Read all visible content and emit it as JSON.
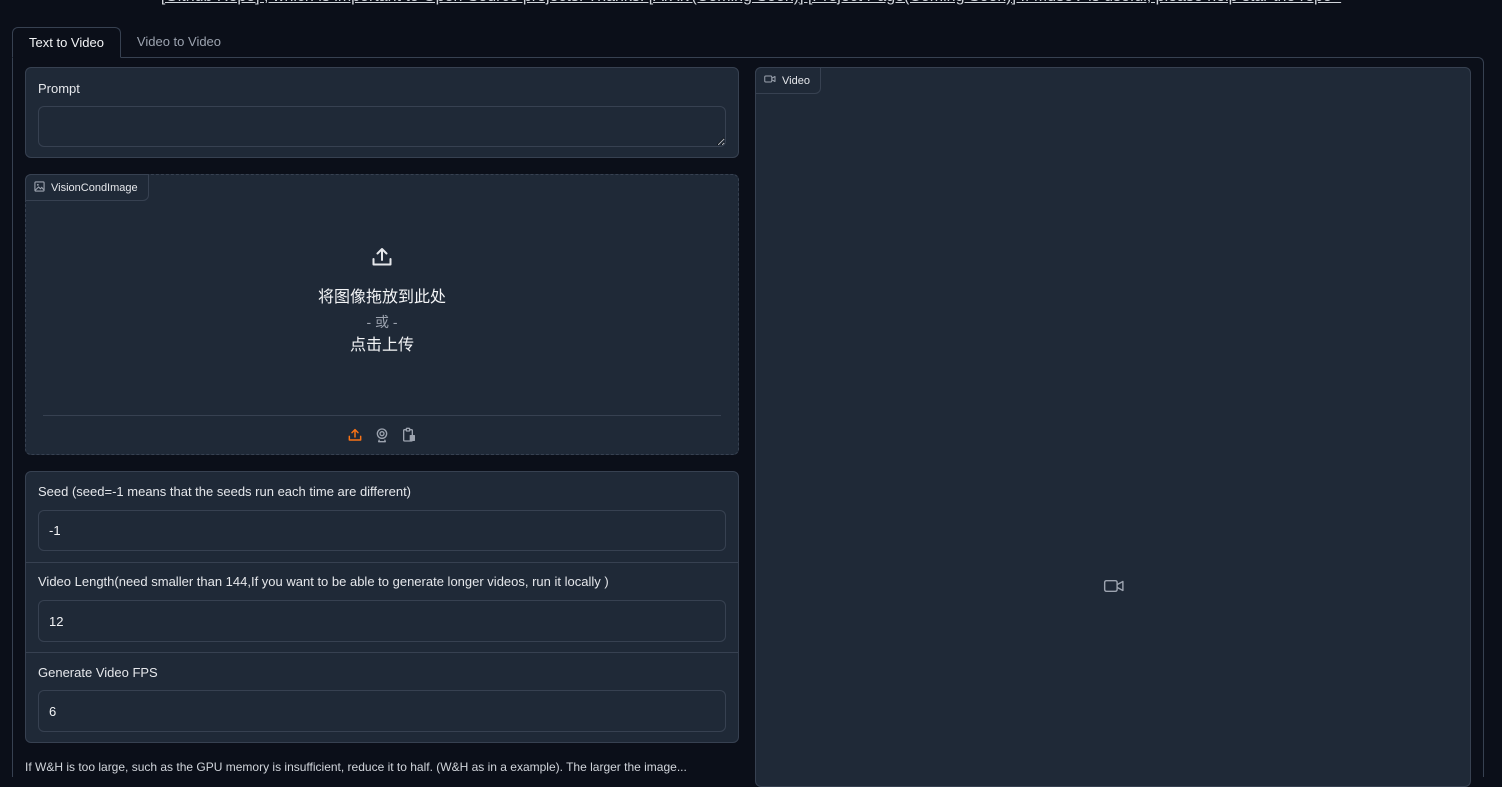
{
  "banner": {
    "text": "[Github Repo] , which is important to Open-Source projects. Thanks! [ArXiv(Coming Soon)] [Project Page(Coming Soon)] If MuseV is useful, please help star the repo~"
  },
  "tabs": [
    {
      "label": "Text to Video",
      "active": true
    },
    {
      "label": "Video to Video",
      "active": false
    }
  ],
  "prompt": {
    "label": "Prompt",
    "value": "",
    "placeholder": ""
  },
  "vision_cond_image": {
    "label": "VisionCondImage",
    "drop_text": "将图像拖放到此处",
    "or_text": "- 或 -",
    "click_text": "点击上传",
    "sources": [
      "upload-icon",
      "webcam-icon",
      "clipboard-icon"
    ],
    "active_source_color": "#f97316"
  },
  "seed": {
    "label": "Seed (seed=-1 means that the seeds run each time are different)",
    "value": "-1"
  },
  "video_length": {
    "label": "Video Length(need smaller than 144,If you want to be able to generate longer videos, run it locally )",
    "value": "12"
  },
  "fps": {
    "label": "Generate Video FPS",
    "value": "6"
  },
  "video_output": {
    "label": "Video"
  },
  "bottom_note": {
    "text": "If W&H is too large, such as the GPU memory is insufficient, reduce it to half. (W&H as in a example). The larger the image..."
  }
}
